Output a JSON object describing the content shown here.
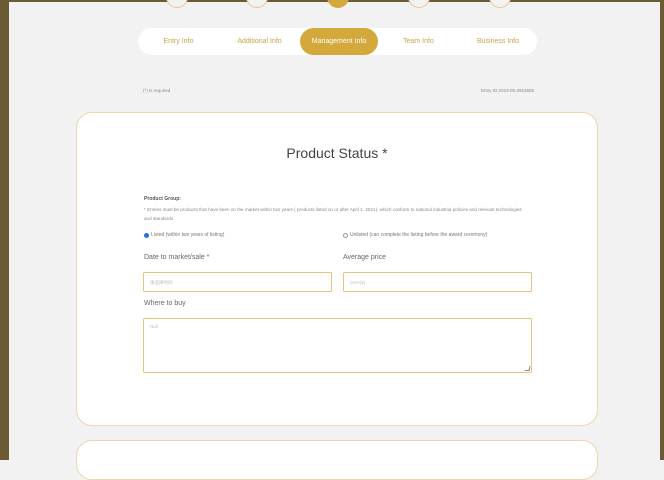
{
  "tabs": [
    {
      "label": "Entry Info"
    },
    {
      "label": "Additional Info"
    },
    {
      "label": "Management Info"
    },
    {
      "label": "Team Info"
    },
    {
      "label": "Business Info"
    }
  ],
  "required_note": "(*) Is required",
  "entry_id": "Entry ID:2023-05-2923806",
  "card": {
    "title": "Product Status *",
    "group_label": "Product Group:",
    "group_note": "* Entries must be products that have been on the market within two years ( products listed on or after April 1, 2021), which conform to national industrial policies and relevant technologies and standards",
    "radio_listed": "Listed (within two years of listing)",
    "radio_unlisted": "Unlisted (can complete the listing before the award ceremony)",
    "date_label": "Date to market/sale *",
    "date_placeholder": "请选择时间",
    "price_label": "Average price",
    "price_placeholder": "CNY(¥)",
    "where_label": "Where to buy",
    "where_placeholder": "Null"
  },
  "colors": {
    "accent": "#d4a93b",
    "border": "#e8c47a"
  }
}
